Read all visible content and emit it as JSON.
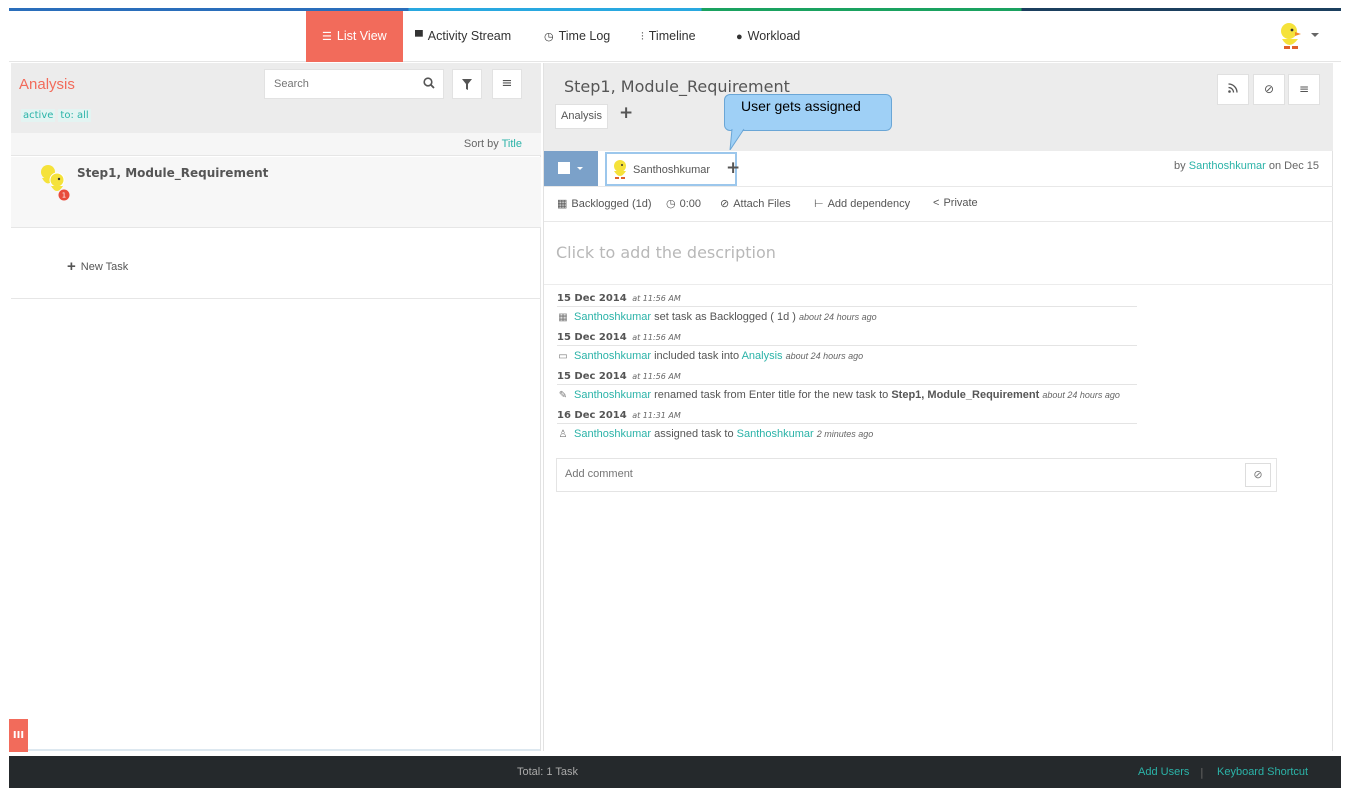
{
  "nav": {
    "items": [
      {
        "label": "List View",
        "icon": "list-icon",
        "active": true
      },
      {
        "label": "Activity Stream",
        "icon": "comment-icon"
      },
      {
        "label": "Time Log",
        "icon": "clock-icon"
      },
      {
        "label": "Timeline",
        "icon": "sliders-icon"
      },
      {
        "label": "Workload",
        "icon": "user-icon"
      }
    ],
    "accent": "#f26b5b"
  },
  "left": {
    "title": "Analysis",
    "filters": [
      "active",
      "to: all"
    ],
    "search_placeholder": "Search",
    "sort_label": "Sort by",
    "sort_field": "Title",
    "task_title": "Step1, Module_Requirement",
    "task_badge": "1",
    "new_task_label": "New Task"
  },
  "detail": {
    "title": "Step1, Module_Requirement",
    "tag": "Analysis",
    "assignee": "Santhoshkumar",
    "by_prefix": "by",
    "by_user": "Santhoshkumar",
    "by_suffix": "on Dec 15",
    "props": {
      "status": "Backlogged (1d)",
      "time": "0:00",
      "attach": "Attach Files",
      "dependency": "Add dependency",
      "privacy": "Private"
    },
    "description_placeholder": "Click to add the description",
    "comment_placeholder": "Add comment"
  },
  "activity": [
    {
      "date": "15 Dec 2014",
      "time": "at 11:56 AM",
      "icon": "calendar-icon",
      "user": "Santhoshkumar",
      "text": "set task as Backlogged ( 1d )",
      "ago": "about 24 hours ago"
    },
    {
      "date": "15 Dec 2014",
      "time": "at 11:56 AM",
      "icon": "folder-icon",
      "user": "Santhoshkumar",
      "text": "included task into",
      "target": "Analysis",
      "ago": "about 24 hours ago"
    },
    {
      "date": "15 Dec 2014",
      "time": "at 11:56 AM",
      "icon": "pencil-icon",
      "user": "Santhoshkumar",
      "text": "renamed task from Enter title for the new task to",
      "bold": "Step1, Module_Requirement",
      "ago": "about 24 hours ago"
    },
    {
      "date": "16 Dec 2014",
      "time": "at 11:31 AM",
      "icon": "user-assign-icon",
      "user": "Santhoshkumar",
      "text": "assigned task to",
      "target": "Santhoshkumar",
      "ago": "2 minutes ago"
    }
  ],
  "callout": "User gets assigned",
  "footer": {
    "total": "Total: 1 Task",
    "add_users": "Add Users",
    "separator": "|",
    "shortcut": "Keyboard Shortcut"
  },
  "colors": {
    "teal": "#2bb3a8",
    "status_blue": "#7ba1c9",
    "footer_bg": "#25292c"
  }
}
